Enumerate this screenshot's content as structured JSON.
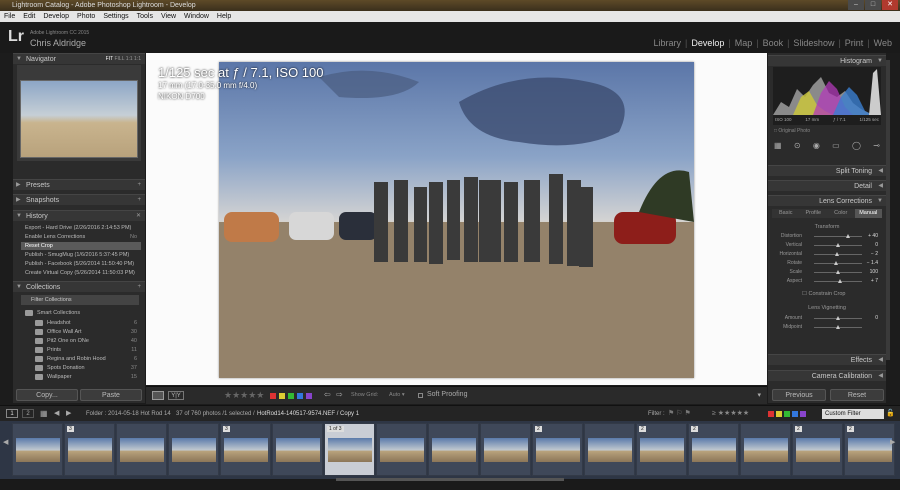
{
  "window": {
    "title": "Lightroom Catalog - Adobe Photoshop Lightroom - Develop",
    "buttons": [
      "–",
      "□",
      "✕"
    ]
  },
  "menu": [
    "File",
    "Edit",
    "Develop",
    "Photo",
    "Settings",
    "Tools",
    "View",
    "Window",
    "Help"
  ],
  "identity": {
    "logo": "Lr",
    "version": "Adobe Lightroom CC 2015",
    "user": "Chris Aldridge"
  },
  "modules": [
    "Library",
    "Develop",
    "Map",
    "Book",
    "Slideshow",
    "Print",
    "Web"
  ],
  "left": {
    "navigator": {
      "title": "Navigator",
      "zoom": [
        "FIT",
        "FILL",
        "1:1",
        "1:1"
      ]
    },
    "presets": "Presets",
    "snapshots": "Snapshots",
    "history": {
      "title": "History",
      "items": [
        {
          "label": "Export - Hard Drive (2/26/2016 2:14:53 PM)",
          "value": ""
        },
        {
          "label": "Enable Lens Corrections",
          "value": "No"
        },
        {
          "label": "Reset Crop",
          "value": ""
        },
        {
          "label": "Publish - SmugMug (1/6/2016 5:37:45 PM)",
          "value": ""
        },
        {
          "label": "Publish - Facebook (5/26/2014 11:50:40 PM)",
          "value": ""
        },
        {
          "label": "Create Virtual Copy (5/26/2014 11:50:03 PM)",
          "value": ""
        }
      ]
    },
    "collections": {
      "title": "Collections",
      "filter": "Filter Collections",
      "smart": "Smart Collections",
      "items": [
        {
          "label": "Headshot",
          "count": "6"
        },
        {
          "label": "Office Wall Art",
          "count": "30"
        },
        {
          "label": "Pit2 One on ONe",
          "count": "40"
        },
        {
          "label": "Prints",
          "count": "11"
        },
        {
          "label": "Regina and Robin Hood",
          "count": "6"
        },
        {
          "label": "Spots Donation",
          "count": "37"
        },
        {
          "label": "Wallpaper",
          "count": "15"
        }
      ]
    },
    "copy_label": "Copy...",
    "paste_label": "Paste"
  },
  "photo_info": {
    "exposure": "1/125 sec at ƒ / 7.1, ISO 100",
    "lens": "17 mm (17.0-35.0 mm f/4.0)",
    "camera": "NIKON D700"
  },
  "toolbar": {
    "rating": "★★★★★",
    "show_grid": "Show Grid:",
    "auto": "Auto ▾",
    "soft_proofing": "Soft Proofing"
  },
  "right": {
    "histogram": {
      "title": "Histogram",
      "iso": "ISO 100",
      "focal": "17 mm",
      "aperture": "ƒ / 7.1",
      "shutter": "1/125 sec",
      "original": "Original Photo"
    },
    "split_toning": "Split Toning",
    "detail": "Detail",
    "lens_corrections": {
      "title": "Lens Corrections",
      "tabs": [
        "Basic",
        "Profile",
        "Color",
        "Manual"
      ],
      "transform": "Transform",
      "sliders": [
        {
          "label": "Distortion",
          "value": "+ 40",
          "pos": 0.7
        },
        {
          "label": "Vertical",
          "value": "0",
          "pos": 0.5
        },
        {
          "label": "Horizontal",
          "value": "− 2",
          "pos": 0.48
        },
        {
          "label": "Rotate",
          "value": "− 1.4",
          "pos": 0.46
        },
        {
          "label": "Scale",
          "value": "100",
          "pos": 0.5
        },
        {
          "label": "Aspect",
          "value": "+ 7",
          "pos": 0.54
        }
      ],
      "constrain": "Constrain Crop",
      "vignetting": "Lens Vignetting",
      "vig_sliders": [
        {
          "label": "Amount",
          "value": "0",
          "pos": 0.5
        },
        {
          "label": "Midpoint",
          "value": "",
          "pos": 0.5
        }
      ]
    },
    "effects": "Effects",
    "camera_calibration": "Camera Calibration",
    "previous_label": "Previous",
    "reset_label": "Reset"
  },
  "filmstrip_bar": {
    "pages": [
      "1",
      "2"
    ],
    "folder": "Folder : 2014-05-18 Hot Rod 14",
    "count": "37 of 760 photos /1 selected /",
    "file": "HotRod14-140517-9574.NEF / Copy 1",
    "filter": "Filter :",
    "custom": "Custom Filter"
  },
  "filmstrip": [
    {
      "badge": ""
    },
    {
      "badge": "3"
    },
    {
      "badge": ""
    },
    {
      "badge": ""
    },
    {
      "badge": "3"
    },
    {
      "badge": ""
    },
    {
      "badge": "1 of 3",
      "selected": true
    },
    {
      "badge": ""
    },
    {
      "badge": ""
    },
    {
      "badge": ""
    },
    {
      "badge": "2"
    },
    {
      "badge": ""
    },
    {
      "badge": "2"
    },
    {
      "badge": "2"
    },
    {
      "badge": ""
    },
    {
      "badge": "2"
    },
    {
      "badge": "2"
    }
  ],
  "colors": {
    "accent": "#eeeeee",
    "panel": "#2b2b2b",
    "filmstrip": "#2e3645"
  }
}
